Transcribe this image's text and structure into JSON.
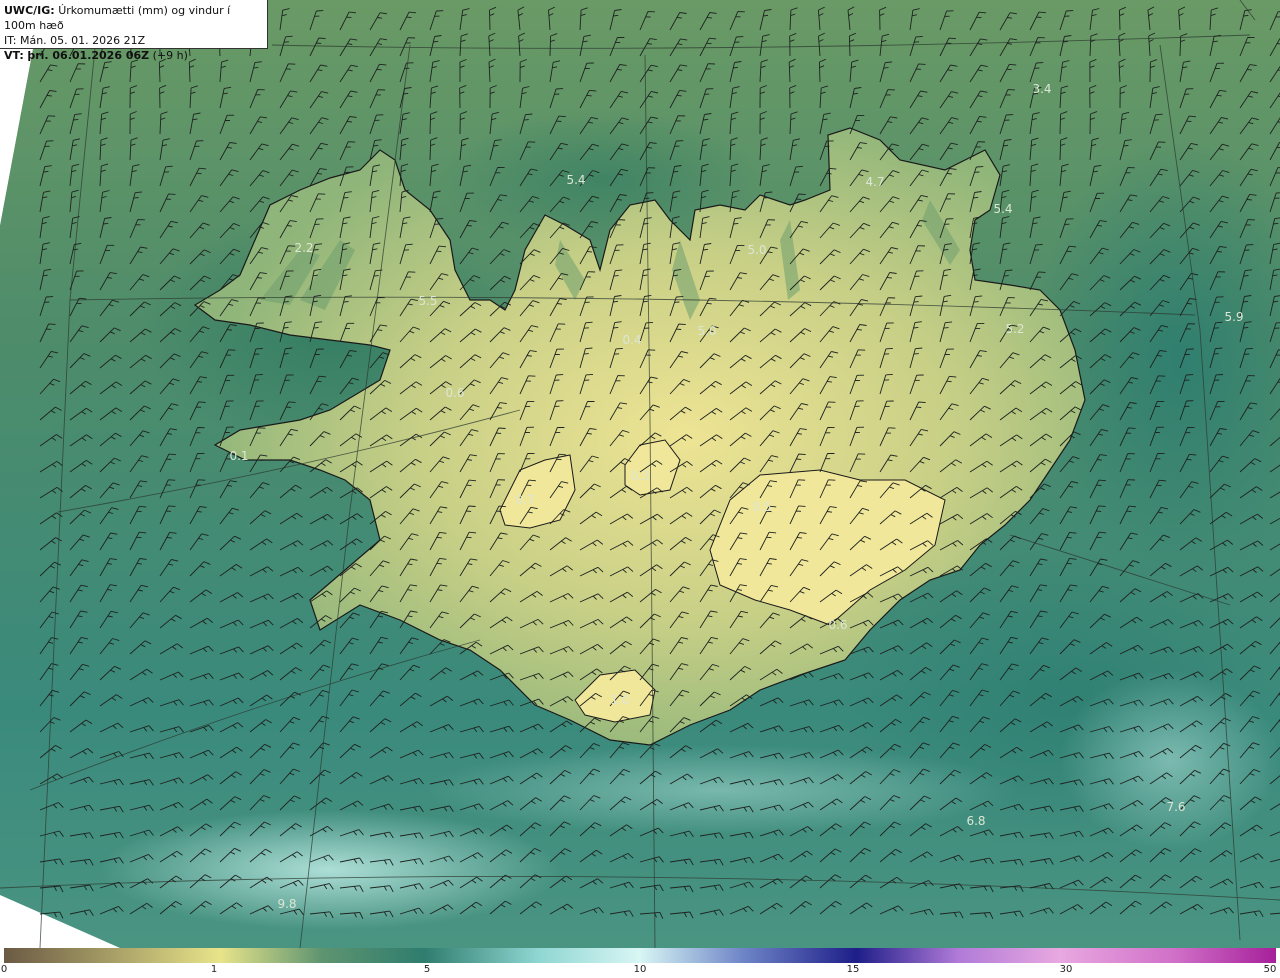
{
  "title": {
    "product": "UWC/IG:",
    "description": "Úrkomumætti (mm) og vindur í 100m hæð",
    "issue_time": "IT: Mán. 05. 01. 2026 21Z",
    "valid_prefix": "VT:",
    "valid_time": "þri. 06.01.2026 06Z",
    "lead": "(+9 h)"
  },
  "value_labels": [
    "3.4",
    "4.7",
    "5.4",
    "5.4",
    "5.0",
    "5.5",
    "5.0",
    "5.2",
    "5.9",
    "6.8",
    "7.6",
    "9.8",
    "2.2",
    "0.4",
    "0.1",
    "0.3",
    "0.7",
    "0.5",
    "1.0",
    "0.6",
    "0.6"
  ],
  "colorbar": {
    "ticks": [
      "0",
      "1",
      "5",
      "10",
      "15",
      "30",
      "50"
    ],
    "colors": [
      "#6b5a44",
      "#a39a64",
      "#e8e48a",
      "#5e9470",
      "#2f7d6e",
      "#8fd6d2",
      "#d8f6f4",
      "#6f86c8",
      "#1e1e88",
      "#b07ad8",
      "#e8a8e0",
      "#d070c8",
      "#a6209a"
    ]
  },
  "map_colors": {
    "ocean_north": "#5f9468",
    "ocean_south": "#3f8a7a",
    "land_high": "#eae290",
    "coast_line": "#1a1a1a"
  }
}
